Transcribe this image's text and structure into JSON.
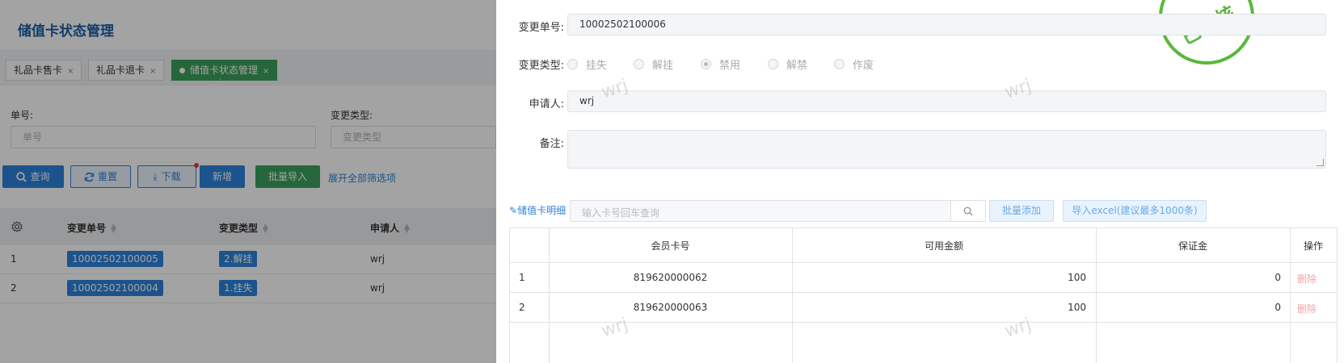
{
  "page": {
    "title": "储值卡状态管理",
    "tabs": [
      {
        "label": "礼品卡售卡"
      },
      {
        "label": "礼品卡退卡"
      },
      {
        "label": "储值卡状态管理"
      }
    ],
    "close_glyph": "×",
    "filters": {
      "order_no_label": "单号:",
      "order_no_placeholder": "单号",
      "change_type_label": "变更类型:",
      "change_type_placeholder": "变更类型"
    },
    "toolbar": {
      "query": "查询",
      "reset": "重置",
      "download": "下载",
      "add": "新增",
      "batch_import": "批量导入",
      "expand_filters": "展开全部筛选项"
    },
    "table": {
      "headers": [
        "变更单号",
        "变更类型",
        "申请人"
      ],
      "rows": [
        {
          "index": "1",
          "order_no": "10002502100005",
          "type": "2.解挂",
          "applicant": "wrj"
        },
        {
          "index": "2",
          "order_no": "10002502100004",
          "type": "1.挂失",
          "applicant": "wrj"
        }
      ]
    }
  },
  "drawer": {
    "order_no_label": "变更单号:",
    "order_no_value": "10002502100006",
    "change_type_label": "变更类型:",
    "change_types": [
      "挂失",
      "解挂",
      "禁用",
      "解禁",
      "作废"
    ],
    "change_type_selected": "禁用",
    "applicant_label": "申请人:",
    "applicant_value": "wrj",
    "remark_label": "备注:",
    "remark_value": "",
    "stamp_text": "已审核",
    "detail_link": "储值卡明细",
    "card_search_placeholder": "输入卡号回车查询",
    "batch_add": "批量添加",
    "import_excel": "导入excel(建议最多1000条)",
    "table": {
      "headers": [
        "会员卡号",
        "可用金额",
        "保证金",
        "操作"
      ],
      "rows": [
        {
          "index": "1",
          "card_no": "819620000062",
          "amount": "100",
          "deposit": "0",
          "action": "删除"
        },
        {
          "index": "2",
          "card_no": "819620000063",
          "amount": "100",
          "deposit": "0",
          "action": "删除"
        }
      ]
    }
  },
  "watermark": "wrj"
}
